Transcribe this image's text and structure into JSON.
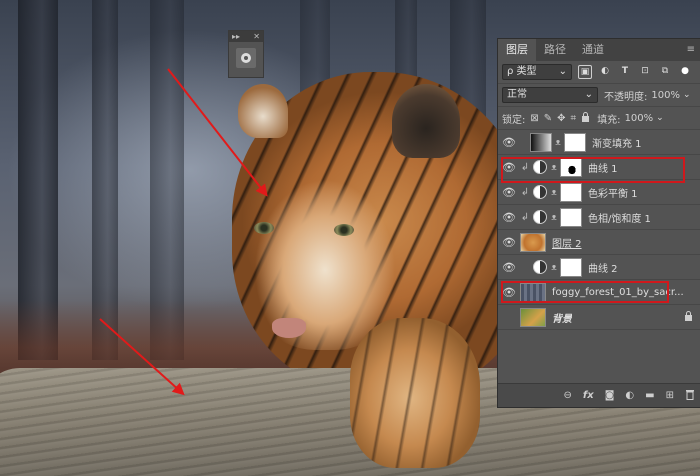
{
  "canvas": {
    "accent": "#e11a1a"
  },
  "mini_panel": {
    "collapse_glyph": "▸▸",
    "close_glyph": "✕",
    "icon": "brush-preset-icon"
  },
  "layers_panel": {
    "tabs": [
      {
        "label": "图层",
        "active": true
      },
      {
        "label": "路径",
        "active": false
      },
      {
        "label": "通道",
        "active": false
      }
    ],
    "menu_glyph": "≡",
    "filter": {
      "kind_prefix": "ρ",
      "kind_label": "类型",
      "icons": [
        "image-filter-icon",
        "adjustment-filter-icon",
        "type-filter-icon",
        "shape-filter-icon",
        "smart-object-filter-icon",
        "filter-toggle-icon"
      ],
      "icon_glyphs": [
        "▣",
        "◐",
        "T",
        "⊡",
        "⧉",
        "●"
      ]
    },
    "blend": {
      "mode": "正常",
      "opacity_label": "不透明度:",
      "opacity_value": "100%"
    },
    "lock": {
      "label": "锁定:",
      "icons": [
        "lock-transparent-icon",
        "lock-image-icon",
        "lock-position-icon",
        "lock-artboard-icon",
        "lock-all-icon"
      ],
      "icon_glyphs": [
        "⊠",
        "✎",
        "✥",
        "⌗",
        "🔒"
      ],
      "fill_label": "填充:",
      "fill_value": "100%"
    },
    "layers": [
      {
        "name": "渐变填充 1",
        "visible": true,
        "clipped": false,
        "type": "gradient"
      },
      {
        "name": "曲线 1",
        "visible": true,
        "clipped": true,
        "type": "adjustment",
        "mask": "dark",
        "highlighted": true
      },
      {
        "name": "色彩平衡 1",
        "visible": true,
        "clipped": true,
        "type": "adjustment"
      },
      {
        "name": "色相/饱和度 1",
        "visible": true,
        "clipped": true,
        "type": "adjustment"
      },
      {
        "name": "图层 2",
        "visible": true,
        "clipped": false,
        "type": "pixel",
        "thumb": "tiger"
      },
      {
        "name": "曲线 2",
        "visible": true,
        "clipped": false,
        "type": "adjustment",
        "highlighted": true
      },
      {
        "name": "foggy_forest_01_by_sacr...",
        "visible": true,
        "clipped": false,
        "type": "pixel",
        "thumb": "forest"
      },
      {
        "name": "背景",
        "visible": false,
        "clipped": false,
        "type": "background",
        "thumb": "bg",
        "locked": true
      }
    ],
    "footer_buttons": [
      {
        "name": "link-layers-icon",
        "glyph": "⊖"
      },
      {
        "name": "layer-style-icon",
        "glyph": "fx"
      },
      {
        "name": "add-mask-icon",
        "glyph": "◙"
      },
      {
        "name": "new-adjustment-icon",
        "glyph": "◐"
      },
      {
        "name": "new-group-icon",
        "glyph": "▬"
      },
      {
        "name": "new-layer-icon",
        "glyph": "⊞"
      },
      {
        "name": "delete-layer-icon",
        "glyph": "🗑"
      }
    ],
    "highlight_color": "#d0181c"
  }
}
